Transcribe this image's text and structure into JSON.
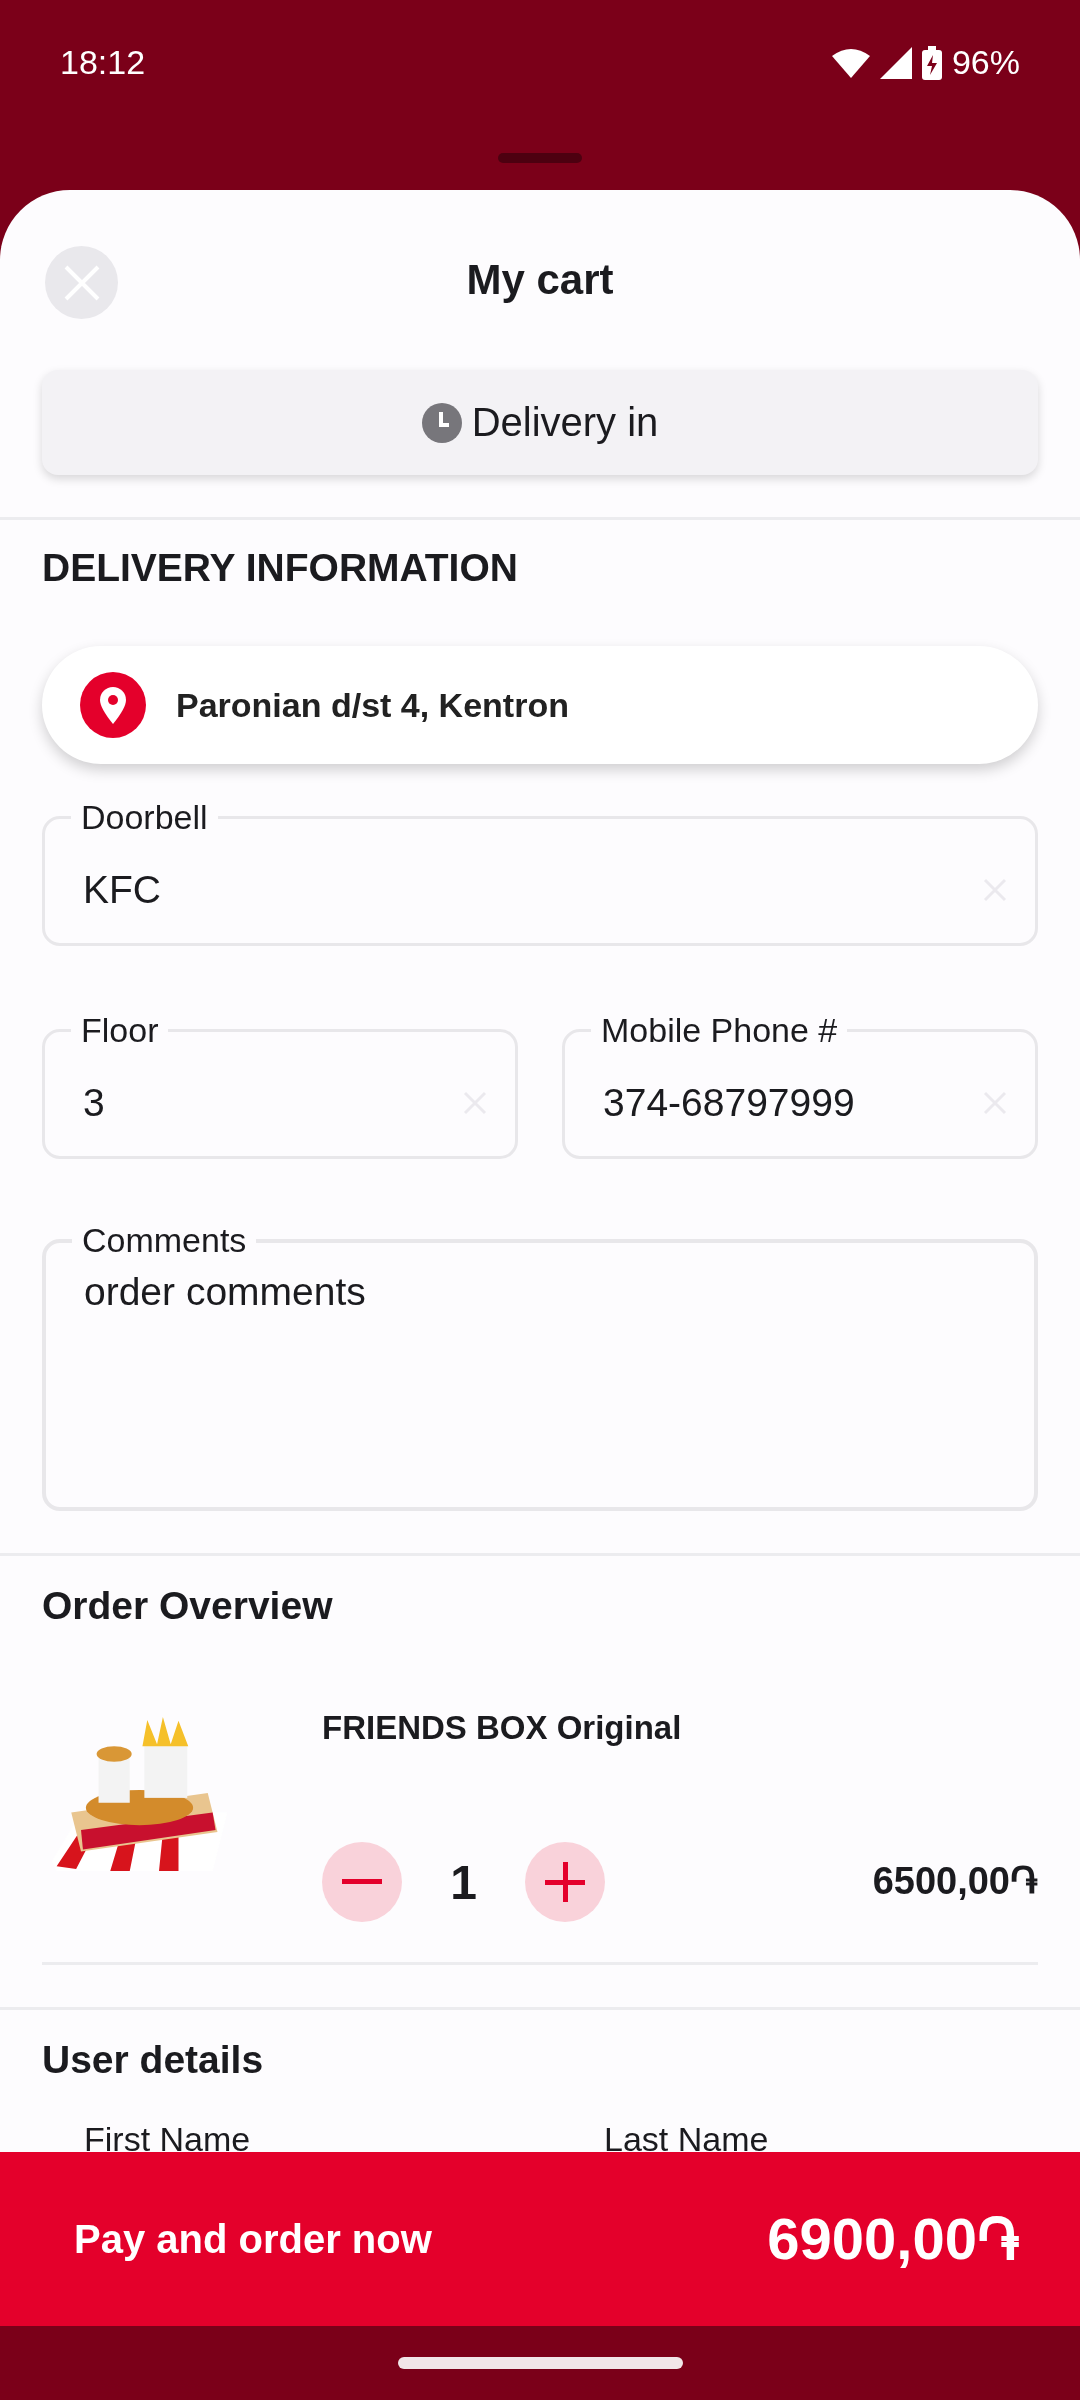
{
  "status_bar": {
    "time": "18:12",
    "battery": "96%"
  },
  "sheet": {
    "title": "My cart",
    "delivery_button": "Delivery in"
  },
  "delivery_information": {
    "heading": "DELIVERY INFORMATION",
    "address": "Paronian d/st 4, Kentron",
    "fields": [
      {
        "label": "Doorbell",
        "value": "KFC",
        "kind": "line"
      },
      {
        "label": "Floor",
        "value": "3",
        "kind": "half"
      },
      {
        "label": "Mobile Phone #",
        "value": "374-68797999",
        "kind": "half"
      },
      {
        "label": "Comments",
        "value": "order comments",
        "kind": "area"
      }
    ]
  },
  "order_overview": {
    "heading": "Order Overview",
    "items": [
      {
        "name": "FRIENDS BOX Original",
        "quantity": "1",
        "price": "6500,00֏"
      }
    ]
  },
  "user_details": {
    "heading": "User details",
    "fields": [
      {
        "label": "First Name"
      },
      {
        "label": "Last Name"
      }
    ]
  },
  "pay_button": {
    "label": "Pay and order now",
    "total": "6900,00֏"
  }
}
